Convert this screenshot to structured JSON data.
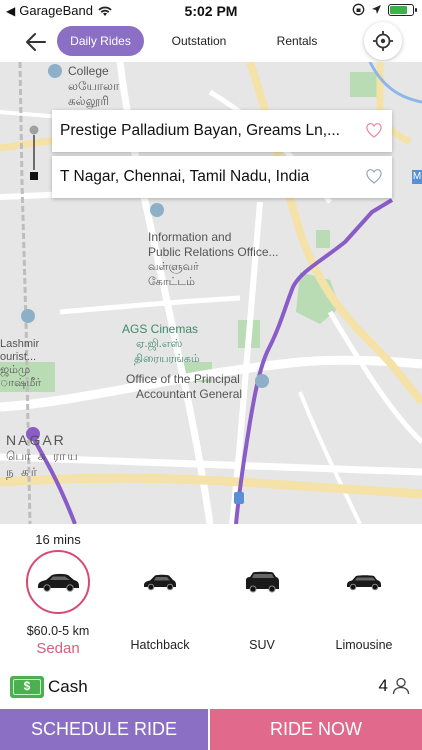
{
  "status_bar": {
    "carrier": "GarageBand",
    "time": "5:02 PM",
    "battery_level": 0.8
  },
  "nav": {
    "tabs": [
      {
        "label": "Daily Rides",
        "active": true
      },
      {
        "label": "Outstation",
        "active": false
      },
      {
        "label": "Rentals",
        "active": false
      }
    ],
    "back_icon": "arrow-left-icon",
    "locate_icon": "crosshair-icon"
  },
  "map": {
    "labels": {
      "college": "College",
      "college_tamil_1": "லயோலா",
      "college_tamil_2": "கல்லூரி",
      "info_1": "Information and",
      "info_2": "Public Relations Office...",
      "info_tamil_1": "வள்ளுவர்",
      "info_tamil_2": "கோட்டம்",
      "cinema": "AGS Cinemas",
      "cinema_tamil_1": "ஏ.ஜி.எஸ்",
      "cinema_tamil_2": "திரையரங்கம்",
      "office_1": "Office of the Principal",
      "office_2": "Accountant General",
      "kashmir_1": "Lashmir",
      "kashmir_2": "ourist...",
      "kashmir_3": "ஜம்மு",
      "kashmir_4": "ாஷ்மீர்",
      "nagar": "NAGAR",
      "nagar_tamil_1": "பொ க ராய",
      "nagar_tamil_2": "ந கர்",
      "metro": "M"
    }
  },
  "route": {
    "pickup": "Prestige Palladium Bayan, Greams Ln,...",
    "drop": "T Nagar, Chennai, Tamil Nadu, India"
  },
  "ride_options": {
    "eta": "16 mins",
    "vehicles": [
      {
        "name": "Sedan",
        "fare": "$60.0-5 km",
        "selected": true,
        "icon": "sedan-car-icon"
      },
      {
        "name": "Hatchback",
        "selected": false,
        "icon": "hatchback-car-icon"
      },
      {
        "name": "SUV",
        "selected": false,
        "icon": "suv-car-icon"
      },
      {
        "name": "Limousine",
        "selected": false,
        "icon": "limousine-car-icon"
      }
    ]
  },
  "payment": {
    "method": "Cash",
    "icon": "cash-icon",
    "seats": "4",
    "seats_icon": "person-icon"
  },
  "actions": {
    "schedule": "SCHEDULE RIDE",
    "ride_now": "RIDE NOW"
  },
  "colors": {
    "primary_purple": "#8b6fc4",
    "accent_pink": "#e0698c",
    "route_purple": "#8a5cc6"
  }
}
